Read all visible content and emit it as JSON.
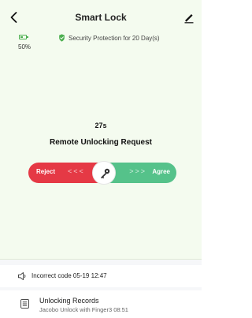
{
  "header": {
    "title": "Smart Lock",
    "back_icon": "back-chevron-icon",
    "edit_icon": "edit-pencil-icon"
  },
  "status": {
    "battery_percent_text": "50%",
    "battery_level": 0.5,
    "security_text": "Security Protection for 20 Day(s)",
    "security_icon": "shield-check-icon",
    "accent_color": "#4caf50"
  },
  "request": {
    "countdown": "27s",
    "title": "Remote Unlocking Request"
  },
  "slider": {
    "reject_label": "Reject",
    "agree_label": "Agree",
    "left_arrows": "<<<",
    "right_arrows": ">>>",
    "knob_icon": "key-icon",
    "reject_color": "#e53945",
    "agree_color": "#55c28a"
  },
  "notice": {
    "icon": "speaker-icon",
    "text": "Incorrect code 05-19 12:47"
  },
  "records": {
    "icon": "document-list-icon",
    "title": "Unlocking Records",
    "subtitle": "Jacobo Unlock with Finger3 08:51"
  }
}
